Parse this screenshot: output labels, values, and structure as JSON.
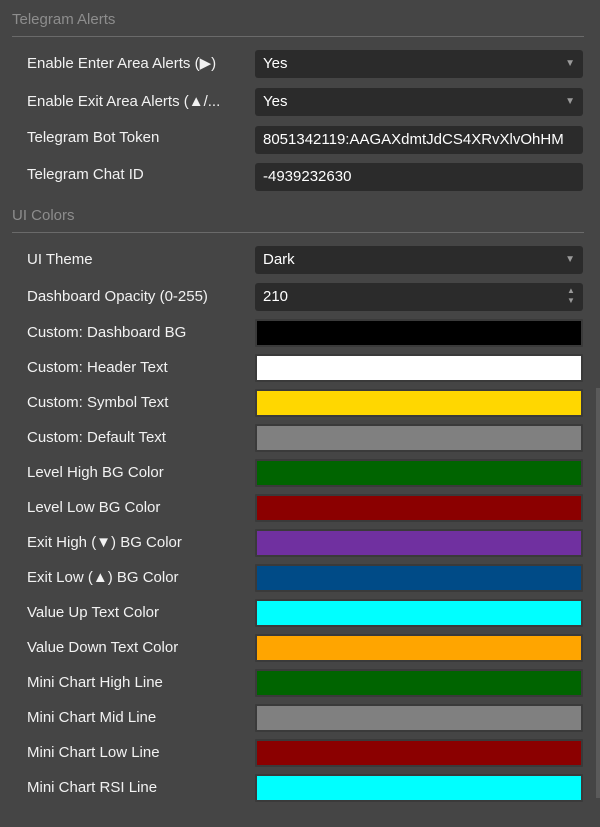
{
  "sections": {
    "telegram": {
      "title": "Telegram Alerts",
      "rows": [
        {
          "label": "Enable Enter Area Alerts (▶)",
          "value": "Yes",
          "control": "dropdown",
          "arrow": "▼"
        },
        {
          "label": "Enable Exit Area Alerts (▲/...",
          "value": "Yes",
          "control": "dropdown",
          "arrow": "▼"
        },
        {
          "label": "Telegram Bot Token",
          "value": "8051342119:AAGAXdmtJdCS4XRvXlvOhHM",
          "control": "text"
        },
        {
          "label": "Telegram Chat ID",
          "value": "-4939232630",
          "control": "text"
        }
      ]
    },
    "ui_colors": {
      "title": "UI Colors",
      "rows": [
        {
          "label": "UI Theme",
          "value": "Dark",
          "control": "dropdown",
          "arrow": "▼"
        },
        {
          "label": "Dashboard Opacity (0-255)",
          "value": "210",
          "control": "spinner",
          "up": "▲",
          "down": "▼"
        },
        {
          "label": "Custom: Dashboard BG",
          "color": "#000000",
          "control": "color"
        },
        {
          "label": "Custom: Header Text",
          "color": "#ffffff",
          "control": "color"
        },
        {
          "label": "Custom: Symbol Text",
          "color": "#ffd700",
          "control": "color"
        },
        {
          "label": "Custom: Default Text",
          "color": "#808080",
          "control": "color"
        },
        {
          "label": "Level High BG Color",
          "color": "#006400",
          "control": "color"
        },
        {
          "label": "Level Low BG Color",
          "color": "#8b0000",
          "control": "color"
        },
        {
          "label": "Exit High (▼) BG Color",
          "color": "#7030a0",
          "control": "color"
        },
        {
          "label": "Exit Low (▲) BG Color",
          "color": "#004b87",
          "control": "color"
        },
        {
          "label": "Value Up Text Color",
          "color": "#00ffff",
          "control": "color"
        },
        {
          "label": "Value Down Text Color",
          "color": "#ffa500",
          "control": "color"
        },
        {
          "label": "Mini Chart High Line",
          "color": "#006400",
          "control": "color"
        },
        {
          "label": "Mini Chart Mid Line",
          "color": "#808080",
          "control": "color"
        },
        {
          "label": "Mini Chart Low Line",
          "color": "#8b0000",
          "control": "color"
        },
        {
          "label": "Mini Chart RSI Line",
          "color": "#00ffff",
          "control": "color"
        }
      ]
    }
  }
}
